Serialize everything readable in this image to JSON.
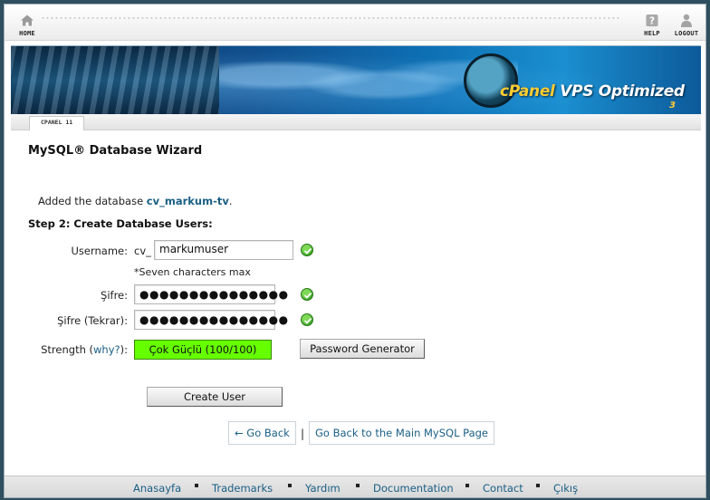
{
  "nav": {
    "home_label": "HOME",
    "help_label": "HELP",
    "logout_label": "LOGOUT"
  },
  "banner": {
    "brand_cpanel": "cPanel",
    "brand_rest": " VPS Optimized",
    "brand_version": "3"
  },
  "tab": {
    "label": "CPANEL 11"
  },
  "page": {
    "title": "MySQL® Database Wizard",
    "added_prefix": "Added the database ",
    "added_db": "cv_markum-tv",
    "added_suffix": ".",
    "step_title": "Step 2: Create Database Users:"
  },
  "form": {
    "username_label": "Username:",
    "username_prefix": "cv_",
    "username_value": "markumuser",
    "username_hint": "*Seven characters max",
    "password_label": "Şifre:",
    "password_value": "●●●●●●●●●●●●●●●",
    "password2_label": "Şifre (Tekrar):",
    "password2_value": "●●●●●●●●●●●●●●●",
    "strength_label": "Strength (",
    "strength_why": "why?",
    "strength_label_end": "):",
    "strength_value": "Çok Güçlü (100/100)",
    "strength_score": 100,
    "password_generator_label": "Password Generator",
    "create_user_label": "Create User"
  },
  "links": {
    "go_back": "← Go Back",
    "separator": "|",
    "go_back_main": "Go Back to the Main MySQL Page"
  },
  "footer": {
    "items": [
      "Anasayfa",
      "Trademarks",
      "Yardım",
      "Documentation",
      "Contact",
      "Çıkış"
    ]
  },
  "colors": {
    "strength_fill": "#66ff00",
    "link": "#1a5f85",
    "valid_check": "#2f9a1f"
  }
}
